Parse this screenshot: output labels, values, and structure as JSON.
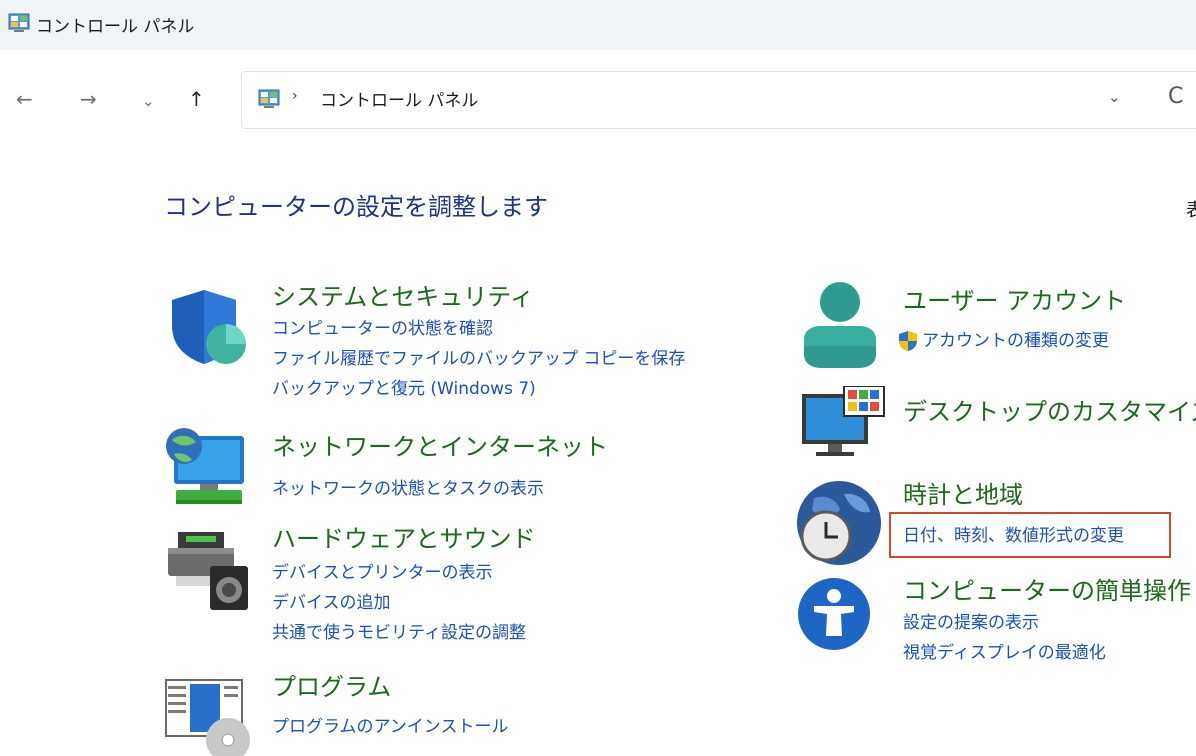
{
  "window": {
    "title": "コントロール パネル"
  },
  "nav": {
    "back_glyph": "←",
    "forward_glyph": "→",
    "recent_glyph": "⌄",
    "up_glyph": "↑"
  },
  "address": {
    "separator": "›",
    "crumb": "コントロール パネル",
    "dropdown_glyph": "⌄",
    "refresh_glyph": "C"
  },
  "heading": "コンピューターの設定を調整します",
  "view_by_partial": "表",
  "categories_left": [
    {
      "title": "システムとセキュリティ",
      "links": [
        "コンピューターの状態を確認",
        "ファイル履歴でファイルのバックアップ コピーを保存",
        "バックアップと復元 (Windows 7)"
      ]
    },
    {
      "title": "ネットワークとインターネット",
      "links": [
        "ネットワークの状態とタスクの表示"
      ]
    },
    {
      "title": "ハードウェアとサウンド",
      "links": [
        "デバイスとプリンターの表示",
        "デバイスの追加",
        "共通で使うモビリティ設定の調整"
      ]
    },
    {
      "title": "プログラム",
      "links": [
        "プログラムのアンインストール"
      ]
    }
  ],
  "categories_right": [
    {
      "title": "ユーザー アカウント",
      "links": [
        "アカウントの種類の変更"
      ]
    },
    {
      "title": "デスクトップのカスタマイズ",
      "links": []
    },
    {
      "title": "時計と地域",
      "links": [
        "日付、時刻、数値形式の変更"
      ]
    },
    {
      "title": "コンピューターの簡単操作",
      "links": [
        "設定の提案の表示",
        "視覚ディスプレイの最適化"
      ]
    }
  ],
  "colors": {
    "title_green": "#1b6a1b",
    "link_blue": "#1a51b8",
    "heading_blue": "#1e3287",
    "highlight_red": "#d9472b"
  }
}
